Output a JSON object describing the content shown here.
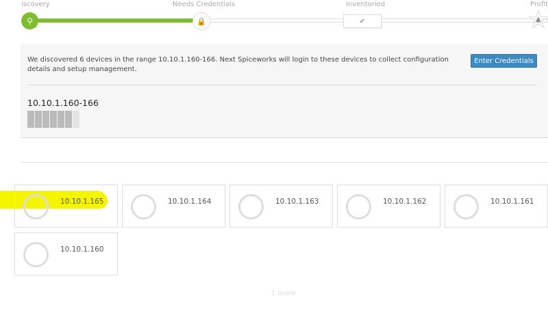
{
  "steps": [
    {
      "label": "iscovery",
      "icon": "search-icon"
    },
    {
      "label": "Needs Credentials",
      "icon": "lock-icon"
    },
    {
      "label": "Inventoried",
      "icon": "check-icon"
    },
    {
      "label": "Profit!",
      "icon": "thumbs-up-icon"
    }
  ],
  "progress_percent": 33,
  "panel": {
    "message": "We discovered 6 devices in the range 10.10.1.160-166. Next Spiceworks will login to these devices to collect configuration details and setup management.",
    "button": "Enter Credentials",
    "range": "10.10.1.160-166",
    "blocks_done": 6,
    "blocks_total": 7
  },
  "devices": [
    "10.10.1.165",
    "10.10.1.164",
    "10.10.1.163",
    "10.10.1.162",
    "10.10.1.161",
    "10.10.1.160"
  ],
  "more": "1 more",
  "colors": {
    "accent": "#7dbd2f",
    "button": "#3d8ac2",
    "highlight": "#f5f500"
  }
}
